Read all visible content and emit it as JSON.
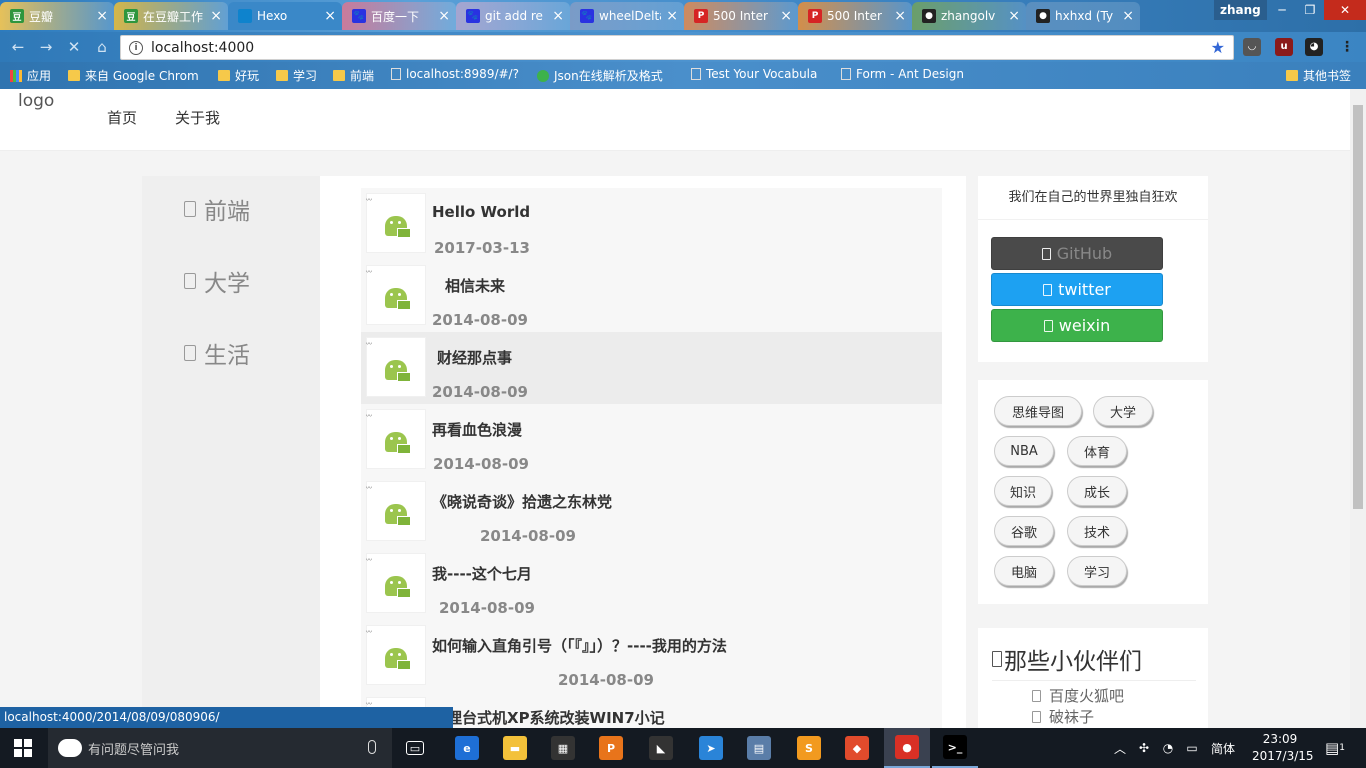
{
  "browser": {
    "tabs": [
      {
        "label": "豆瓣",
        "icon": "douban-icon",
        "color": "#2e963d",
        "fav": "豆"
      },
      {
        "label": "在豆瓣工作",
        "icon": "douban-icon",
        "color": "#2e963d",
        "fav": "豆"
      },
      {
        "label": "Hexo",
        "icon": "hexo-icon",
        "color": "#0e83cd",
        "fav": ""
      },
      {
        "label": "百度一下",
        "icon": "baidu-icon",
        "color": "#2932e1",
        "fav": "🐾"
      },
      {
        "label": "git add re",
        "icon": "baidu-icon",
        "color": "#2932e1",
        "fav": "🐾"
      },
      {
        "label": "wheelDelta",
        "icon": "baidu-icon",
        "color": "#2932e1",
        "fav": "🐾"
      },
      {
        "label": "500 Inter",
        "icon": "p-icon",
        "color": "#d62424",
        "fav": "P"
      },
      {
        "label": "500 Inter",
        "icon": "p-icon",
        "color": "#d62424",
        "fav": "P"
      },
      {
        "label": "zhangolv",
        "icon": "github-icon",
        "color": "#222222",
        "fav": "●"
      },
      {
        "label": "hxhxd (Ty",
        "icon": "github-icon",
        "color": "#222222",
        "fav": "●"
      }
    ],
    "user": "zhang",
    "address": "localhost:4000",
    "bookmarks": [
      {
        "label": "应用",
        "type": "apps"
      },
      {
        "label": "来自 Google Chrom",
        "type": "folder"
      },
      {
        "label": "好玩",
        "type": "folder"
      },
      {
        "label": "学习",
        "type": "folder"
      },
      {
        "label": "前端",
        "type": "folder"
      },
      {
        "label": "localhost:8989/#/?",
        "type": "page"
      },
      {
        "label": "Json在线解析及格式",
        "type": "json"
      },
      {
        "label": "Test Your Vocabula",
        "type": "page"
      },
      {
        "label": "Form - Ant Design",
        "type": "page"
      },
      {
        "label": "其他书签",
        "type": "folder"
      }
    ],
    "status_url": "localhost:4000/2014/08/09/080906/"
  },
  "site": {
    "logo": "logo",
    "nav": [
      "首页",
      "关于我"
    ],
    "categories": [
      "前端",
      "大学",
      "生活"
    ],
    "posts": [
      {
        "title": "Hello World",
        "date": "2017-03-13"
      },
      {
        "title": "相信未来",
        "date": "2014-08-09"
      },
      {
        "title": "财经那点事",
        "date": "2014-08-09"
      },
      {
        "title": "再看血色浪漫",
        "date": "2014-08-09"
      },
      {
        "title": "《晓说奇谈》拾遗之东林党",
        "date": "2014-08-09"
      },
      {
        "title": "我----这个七月",
        "date": "2014-08-09"
      },
      {
        "title": "如何输入直角引号（「『』」）？----我用的方法",
        "date": "2014-08-09"
      },
      {
        "title": "清理台式机XP系统改装WIN7小记",
        "date": ""
      }
    ],
    "motto": "我们在自己的世界里独自狂欢",
    "social": [
      {
        "label": "GitHub",
        "color": "#4a4a4a",
        "text_color": "#888888"
      },
      {
        "label": "twitter",
        "color": "#1da1f2",
        "text_color": "#ffffff"
      },
      {
        "label": "weixin",
        "color": "#3db24b",
        "text_color": "#ffffff"
      }
    ],
    "tags": [
      "思维导图",
      "大学",
      "NBA",
      "体育",
      "知识",
      "成长",
      "谷歌",
      "技术",
      "电脑",
      "学习"
    ],
    "friends_title": "那些小伙伴们",
    "friends": [
      "百度火狐吧",
      "破袜子"
    ]
  },
  "taskbar": {
    "search_placeholder": "有问题尽管问我",
    "apps": [
      "task-view",
      "edge",
      "file-explorer",
      "store",
      "foxit",
      "fiddler",
      "feishu",
      "monitor",
      "sublime",
      "git",
      "chrome",
      "cmd"
    ],
    "ime": "简体",
    "time": "23:09",
    "date": "2017/3/15",
    "notifications": "1"
  }
}
